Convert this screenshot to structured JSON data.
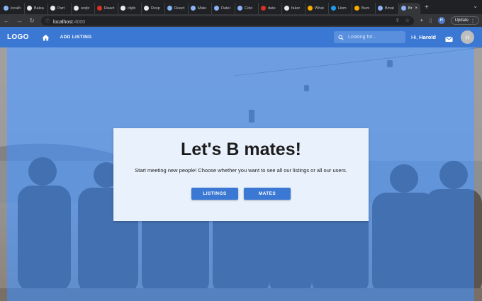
{
  "browser": {
    "tabs": [
      {
        "label": "localh",
        "color": "#8ab4f8"
      },
      {
        "label": "Balsa",
        "color": "#e8eaed"
      },
      {
        "label": "Part",
        "color": "#e8eaed"
      },
      {
        "label": "wojtc",
        "color": "#e8eaed"
      },
      {
        "label": "React",
        "color": "#d93025"
      },
      {
        "label": "clipb",
        "color": "#e8eaed"
      },
      {
        "label": "Resp",
        "color": "#e8eaed"
      },
      {
        "label": "React",
        "color": "#8ab4f8"
      },
      {
        "label": "Mate",
        "color": "#8ab4f8"
      },
      {
        "label": "Datel",
        "color": "#8ab4f8"
      },
      {
        "label": "Colo",
        "color": "#8ab4f8"
      },
      {
        "label": "date",
        "color": "#d93025"
      },
      {
        "label": "faker",
        "color": "#e8eaed"
      },
      {
        "label": "What",
        "color": "#f9ab00"
      },
      {
        "label": "Hom",
        "color": "#1d9bf0"
      },
      {
        "label": "Bum",
        "color": "#f9ab00"
      },
      {
        "label": "Bmat",
        "color": "#8ab4f8"
      }
    ],
    "active_tab": {
      "label": "Br",
      "close": "×"
    },
    "new_tab": "+",
    "url_host": "localhost",
    "url_port": ":4000",
    "profile_initial": "H",
    "update_label": "Update"
  },
  "app": {
    "logo": "LOGO",
    "add_listing": "ADD LISTING",
    "search_placeholder": "Looking for...",
    "greeting_prefix": "Hi, ",
    "user_name": "Harold",
    "avatar_initial": "H"
  },
  "hero": {
    "title": "Let's B mates!",
    "subtitle": "Start meeting new people! Choose whether you want to see all our listings or all our users.",
    "listings_button": "LISTINGS",
    "mates_button": "MATES"
  },
  "colors": {
    "primary": "#3b78d4",
    "card_bg": "#e8f1fc"
  }
}
